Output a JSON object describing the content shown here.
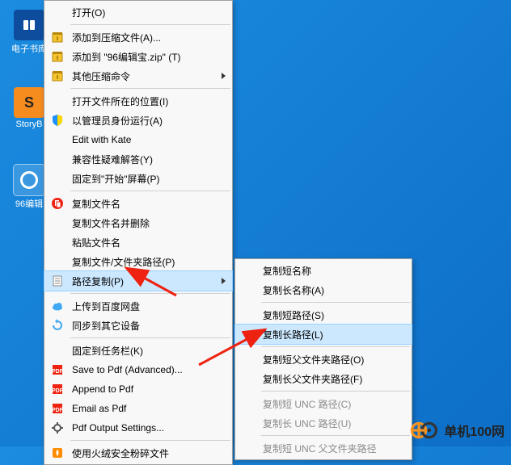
{
  "desktop": {
    "icons": [
      {
        "label": "电子书库",
        "kind": "book"
      },
      {
        "label": "StoryB",
        "kind": "story"
      },
      {
        "label": "96编辑",
        "kind": "editor"
      }
    ]
  },
  "menu": {
    "items": [
      {
        "label": "打开(O)",
        "icon": ""
      },
      {
        "sep": true
      },
      {
        "label": "添加到压缩文件(A)...",
        "icon": "archive"
      },
      {
        "label": "添加到 \"96编辑宝.zip\" (T)",
        "icon": "archive"
      },
      {
        "label": "其他压缩命令",
        "icon": "archive",
        "submenu": true
      },
      {
        "sep": true
      },
      {
        "label": "打开文件所在的位置(I)",
        "icon": ""
      },
      {
        "label": "以管理员身份运行(A)",
        "icon": "shield"
      },
      {
        "label": "Edit with Kate",
        "icon": ""
      },
      {
        "label": "兼容性疑难解答(Y)",
        "icon": ""
      },
      {
        "label": "固定到\"开始\"屏幕(P)",
        "icon": ""
      },
      {
        "sep": true
      },
      {
        "label": "复制文件名",
        "icon": "copy-red"
      },
      {
        "label": "复制文件名并删除",
        "icon": ""
      },
      {
        "label": "粘贴文件名",
        "icon": ""
      },
      {
        "label": "复制文件/文件夹路径(P)",
        "icon": ""
      },
      {
        "label": "路径复制(P)",
        "icon": "doc",
        "submenu": true,
        "highlight": true
      },
      {
        "sep": true
      },
      {
        "label": "上传到百度网盘",
        "icon": "cloud"
      },
      {
        "label": "同步到其它设备",
        "icon": "sync"
      },
      {
        "sep": true
      },
      {
        "label": "固定到任务栏(K)",
        "icon": ""
      },
      {
        "label": "Save to Pdf (Advanced)...",
        "icon": "pdf"
      },
      {
        "label": "Append to Pdf",
        "icon": "pdf"
      },
      {
        "label": "Email as Pdf",
        "icon": "pdf"
      },
      {
        "label": "Pdf Output Settings...",
        "icon": "gear"
      },
      {
        "sep": true
      },
      {
        "label": "使用火绒安全粉碎文件",
        "icon": "huorong"
      }
    ]
  },
  "submenu": {
    "items": [
      {
        "label": "复制短名称"
      },
      {
        "label": "复制长名称(A)"
      },
      {
        "sep": true
      },
      {
        "label": "复制短路径(S)"
      },
      {
        "label": "复制长路径(L)",
        "highlight": true
      },
      {
        "sep": true
      },
      {
        "label": "复制短父文件夹路径(O)"
      },
      {
        "label": "复制长父文件夹路径(F)"
      },
      {
        "sep": true
      },
      {
        "label": "复制短 UNC 路径(C)",
        "disabled": true
      },
      {
        "label": "复制长 UNC 路径(U)",
        "disabled": true
      },
      {
        "sep": true
      },
      {
        "label": "复制短 UNC 父文件夹路径",
        "disabled": true
      }
    ]
  },
  "logo": {
    "text": "单机100网"
  }
}
